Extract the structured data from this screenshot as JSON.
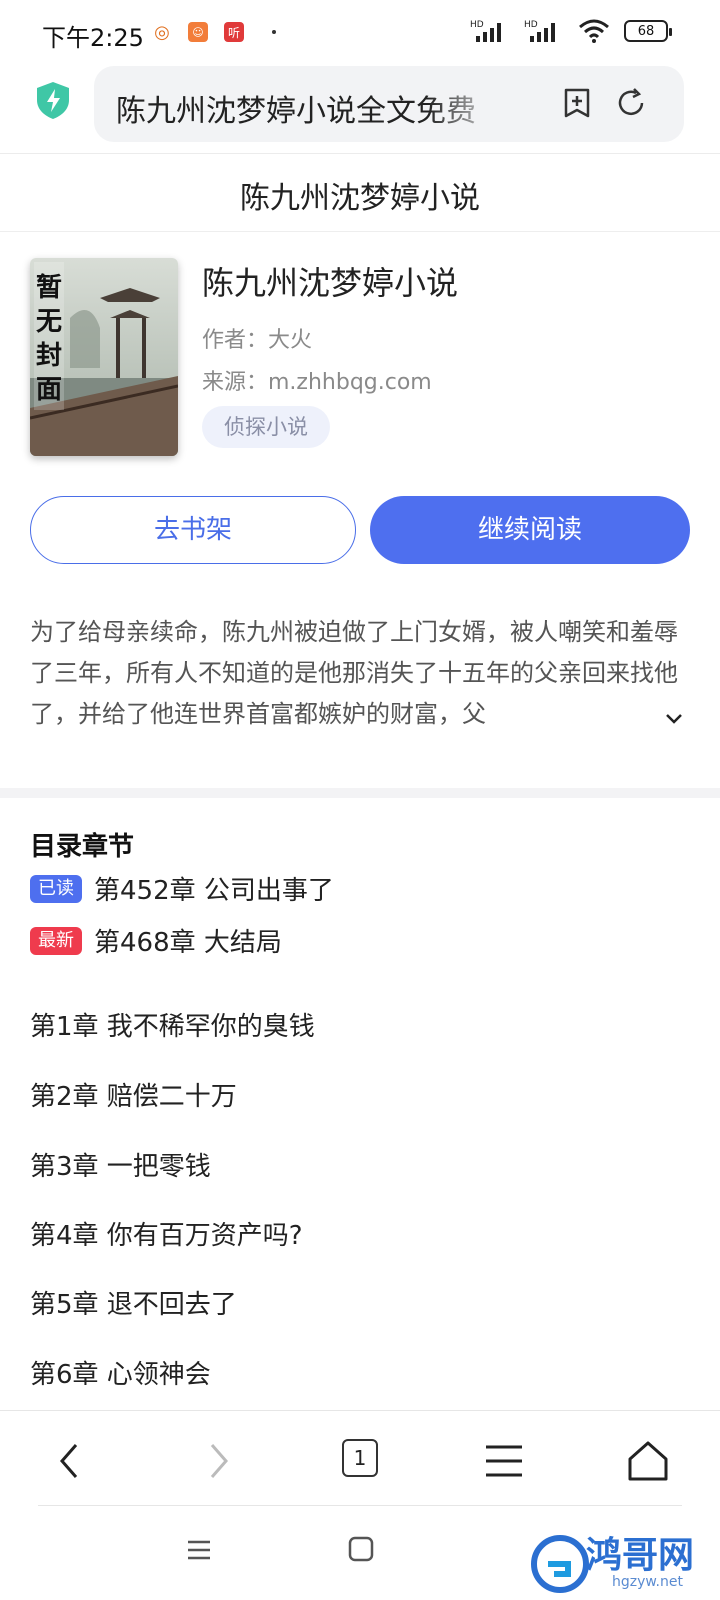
{
  "status_bar": {
    "time": "下午2:25",
    "app_icons": [
      "weibo-icon",
      "face-app-icon",
      "listen-app-icon"
    ],
    "listen_label": "听",
    "network_label_1": "HD",
    "network_label_2": "HD",
    "battery": "68"
  },
  "address_bar": {
    "url_text": "陈九州沈梦婷小说全文免费"
  },
  "page": {
    "title": "陈九州沈梦婷小说"
  },
  "book": {
    "name": "陈九州沈梦婷小说",
    "author": "作者：大火",
    "source": "来源：m.zhhbqg.com",
    "genre": "侦探小说",
    "cover_placeholder": "暂无封面"
  },
  "actions": {
    "shelf_label": "去书架",
    "read_label": "继续阅读"
  },
  "synopsis": "为了给母亲续命，陈九州被迫做了上门女婿，被人嘲笑和羞辱了三年，所有人不知道的是他那消失了十五年的父亲回来找他了，并给了他连世界首富都嫉妒的财富，父",
  "toc": {
    "title": "目录章节",
    "last_read": {
      "badge": "已读",
      "chapter": "第452章 公司出事了"
    },
    "latest": {
      "badge": "最新",
      "chapter": "第468章 大结局"
    },
    "chapters": [
      "第1章 我不稀罕你的臭钱",
      "第2章 赔偿二十万",
      "第3章 一把零钱",
      "第4章 你有百万资产吗?",
      "第5章 退不回去了",
      "第6章 心领神会"
    ]
  },
  "toolbar": {
    "tab_count": "1"
  },
  "watermark": {
    "text": "鸿哥网",
    "sub": "hgzyw.net"
  },
  "colors": {
    "accent": "#4e6fef",
    "latest_badge": "#ef3b4d",
    "shield": "#3fc7a6"
  }
}
